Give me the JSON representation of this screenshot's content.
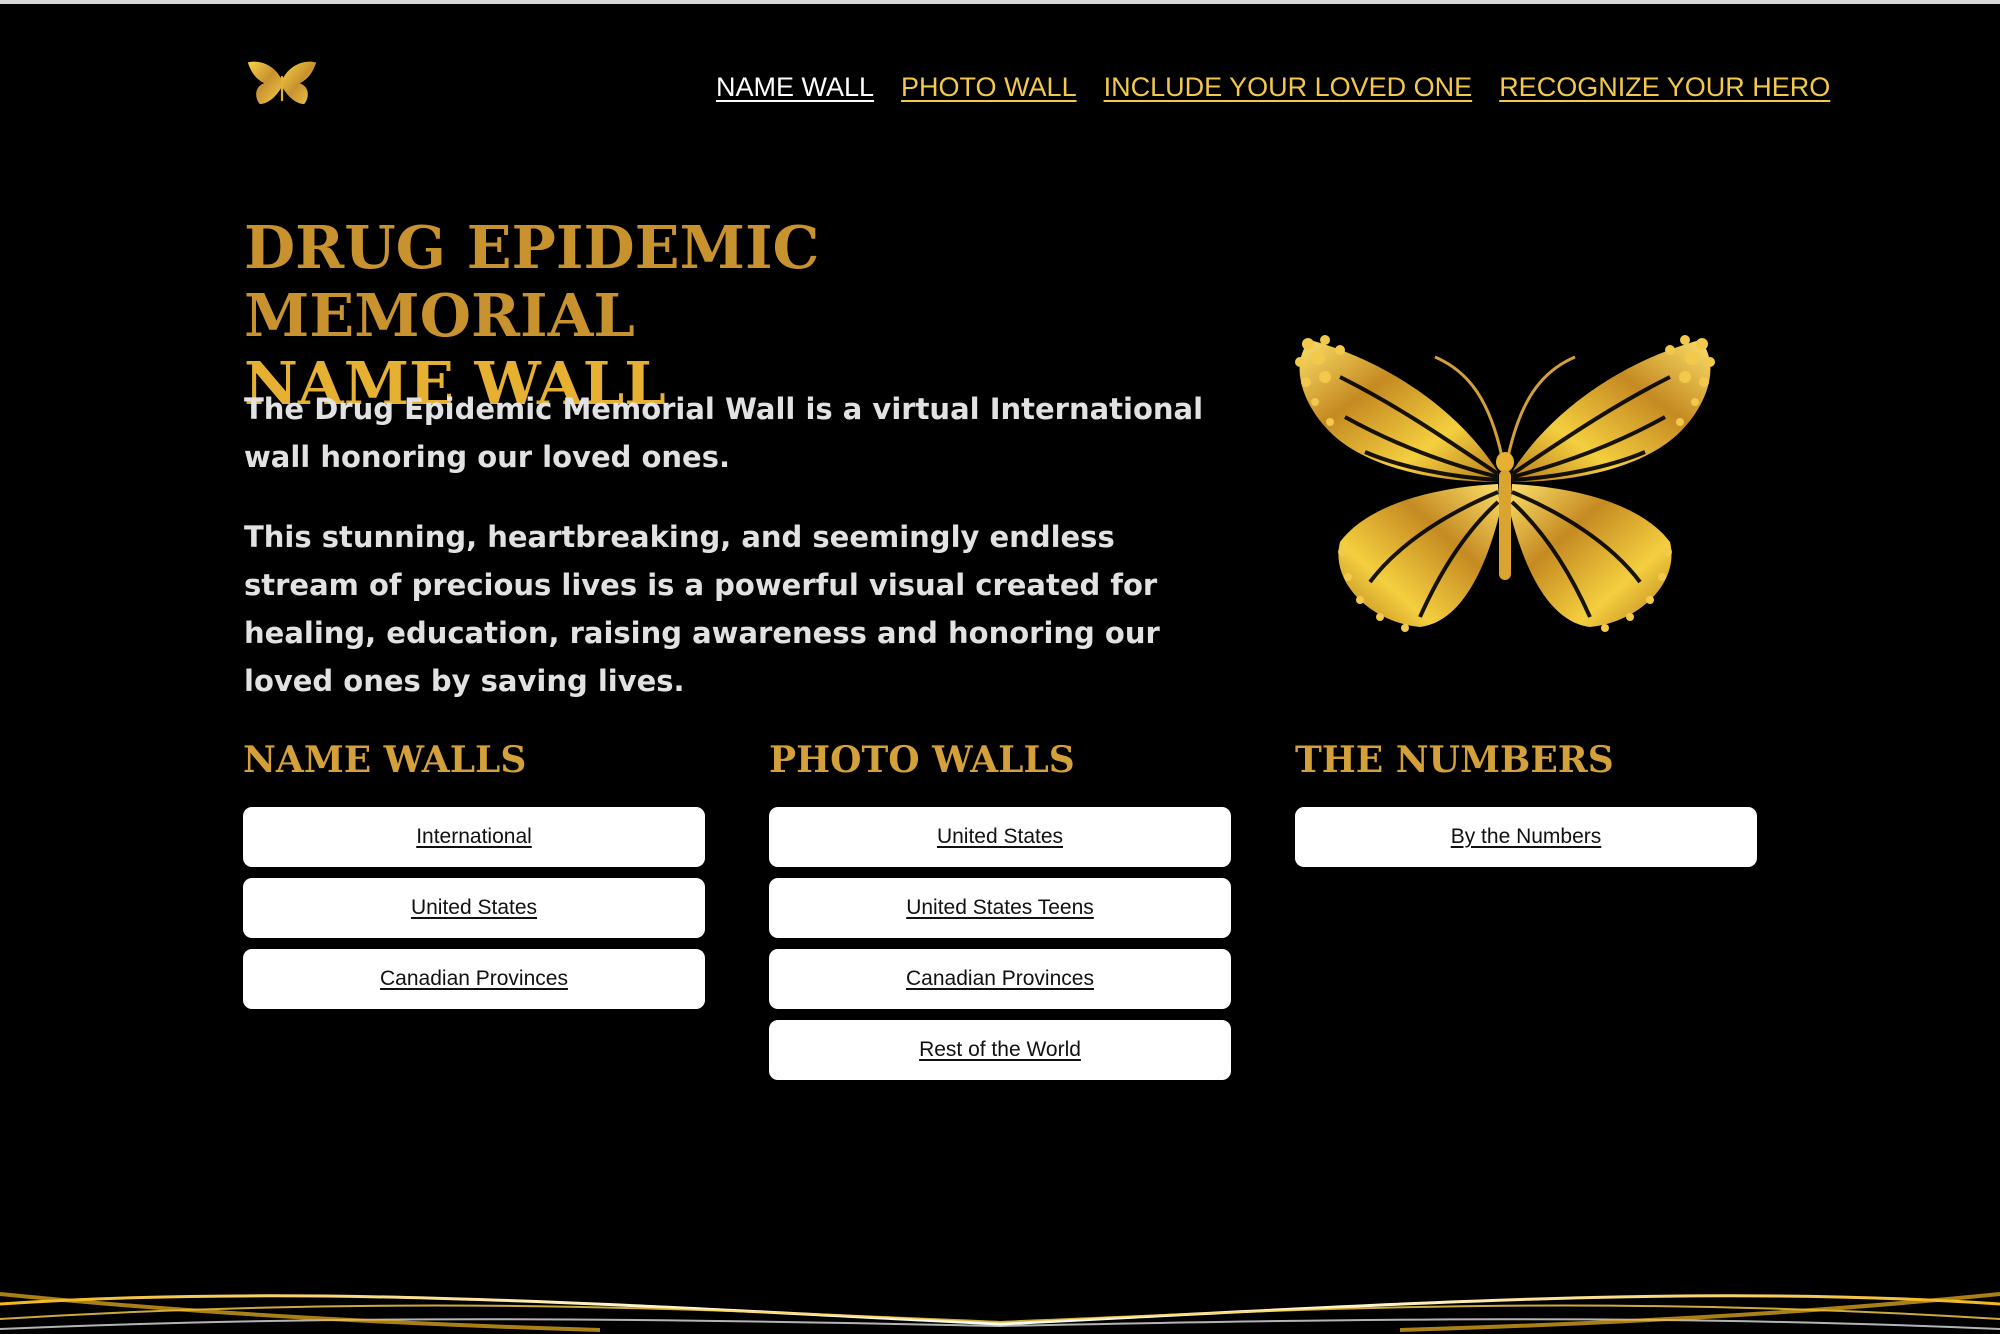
{
  "nav": {
    "items": [
      {
        "label": "NAME WALL",
        "active": true
      },
      {
        "label": "PHOTO WALL",
        "active": false
      },
      {
        "label": "INCLUDE YOUR LOVED ONE",
        "active": false
      },
      {
        "label": "RECOGNIZE YOUR HERO",
        "active": false
      }
    ]
  },
  "logo": {
    "icon": "butterfly-icon"
  },
  "hero": {
    "title_line1": "DRUG EPIDEMIC MEMORIAL",
    "title_line2": "NAME WALL",
    "paragraph1": "The Drug Epidemic Memorial Wall is a virtual International wall honoring our loved ones.",
    "paragraph2": "This stunning, heartbreaking, and seemingly endless stream of precious lives is a powerful visual created for healing, education, raising awareness and honoring our loved ones by saving lives.",
    "image_icon": "butterfly-icon"
  },
  "sections": [
    {
      "title": "NAME WALLS",
      "buttons": [
        "International",
        "United States",
        "Canadian Provinces"
      ]
    },
    {
      "title": "PHOTO WALLS",
      "buttons": [
        "United States",
        "United States Teens",
        "Canadian Provinces",
        "Rest of the World"
      ]
    },
    {
      "title": "THE NUMBERS",
      "buttons": [
        "By the Numbers"
      ]
    }
  ],
  "colors": {
    "background": "#000000",
    "gold": "#d4a03a",
    "gold_bright": "#f2c94c",
    "nav_active": "#ffffff",
    "button_bg": "#ffffff"
  }
}
